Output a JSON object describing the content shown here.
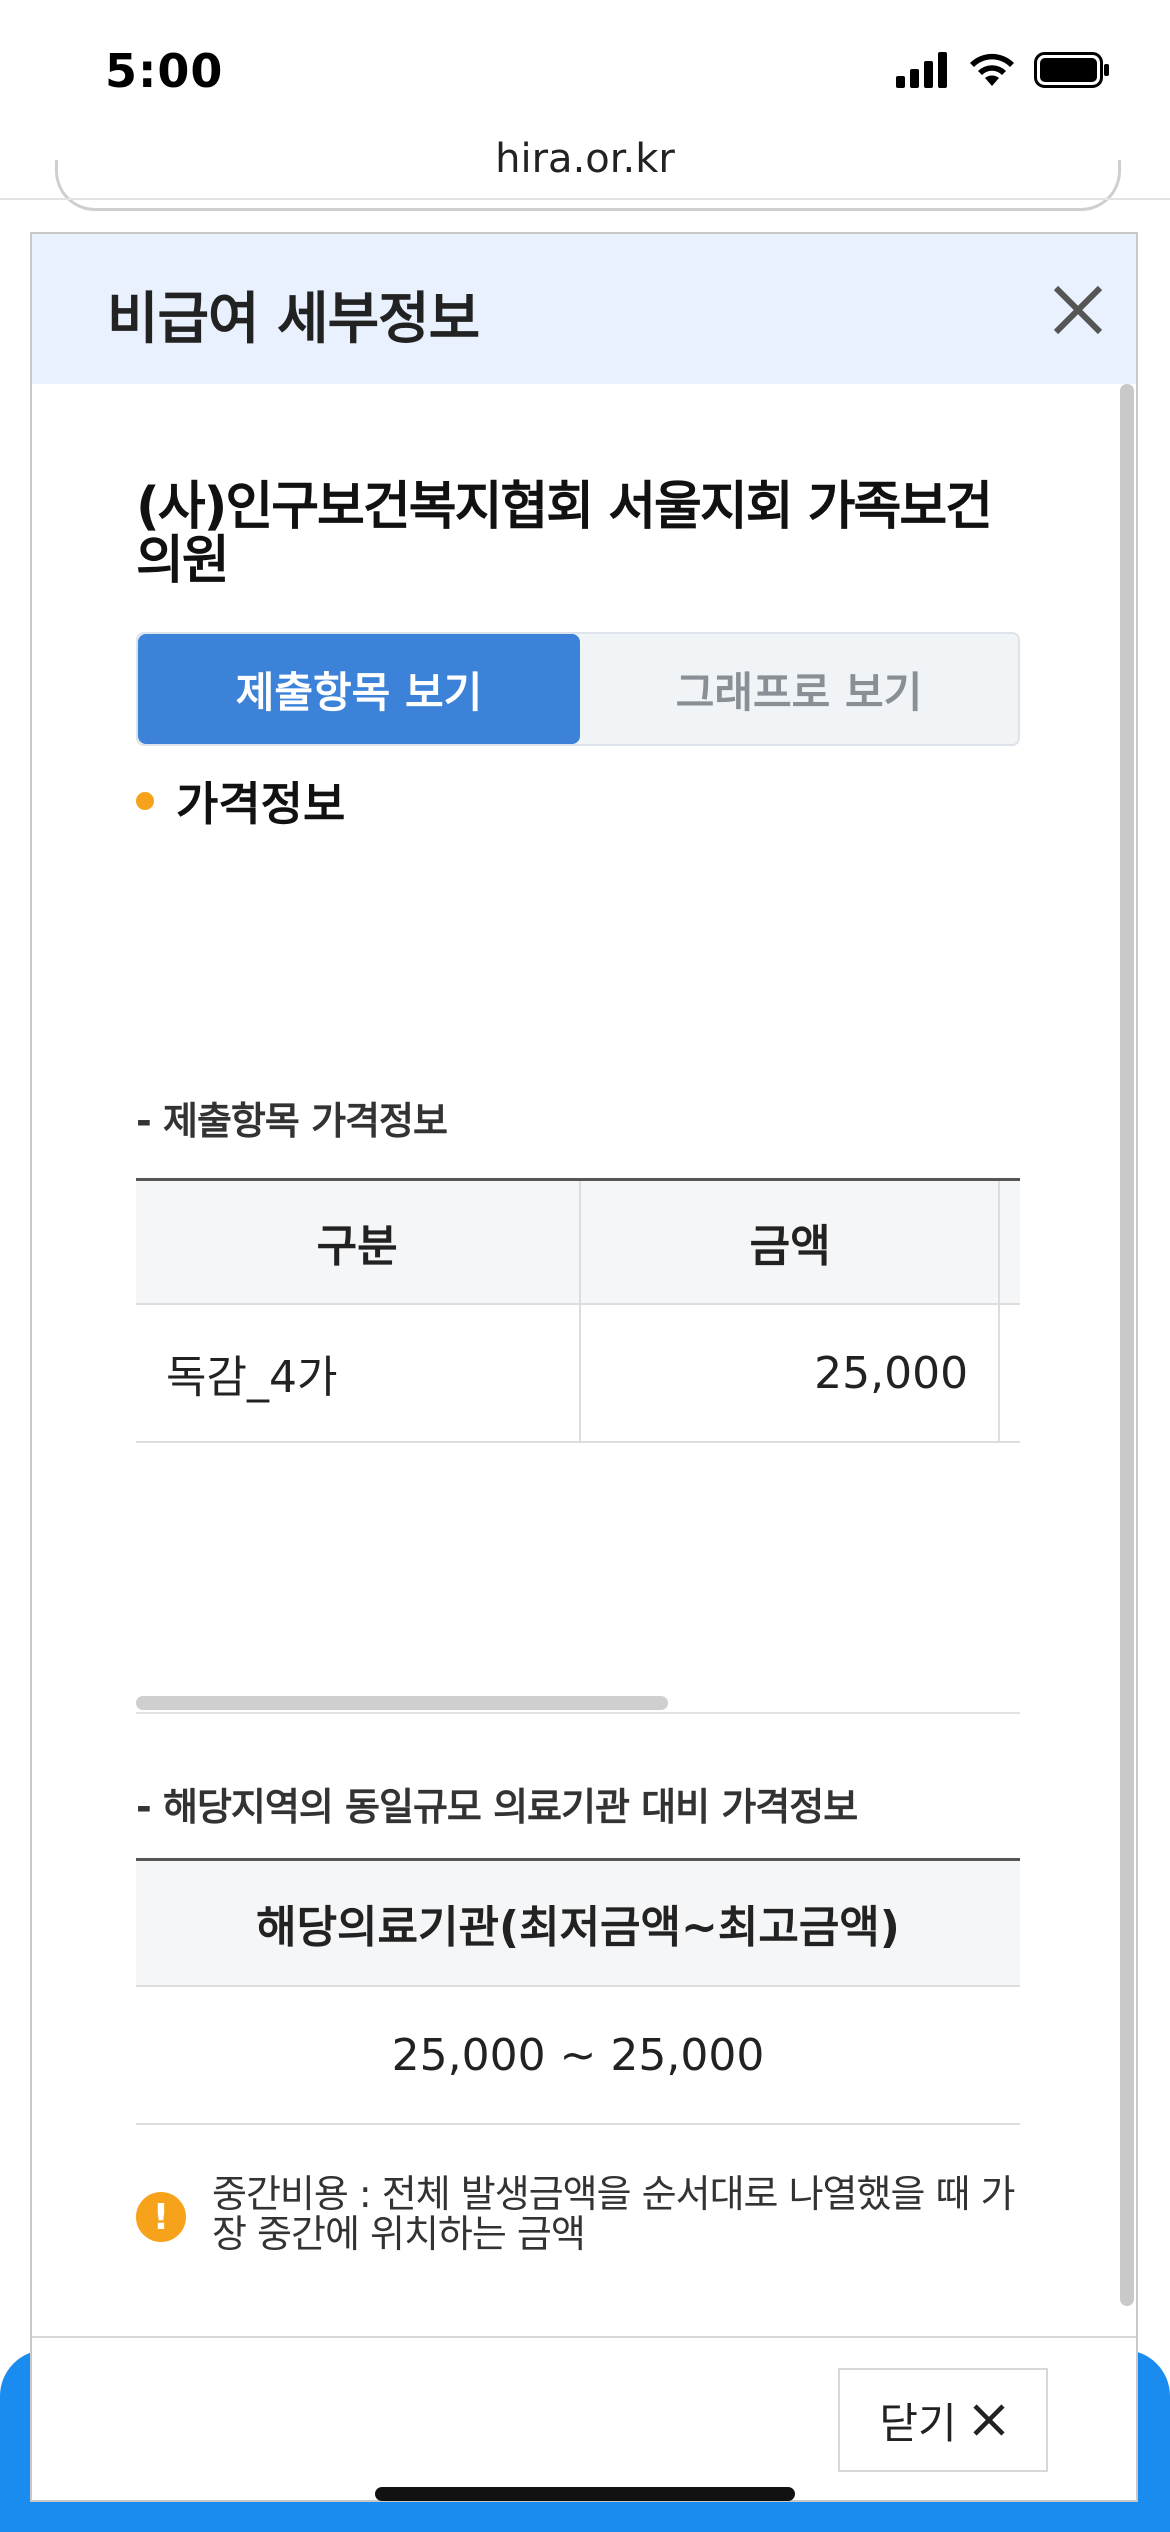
{
  "status": {
    "time": "5:00"
  },
  "browser": {
    "url": "hira.or.kr"
  },
  "modal": {
    "title": "비급여 세부정보",
    "hospital_name": "(사)인구보건복지협회 서울지회 가족보건의원",
    "tabs": {
      "active": "제출항목 보기",
      "inactive": "그래프로 보기"
    },
    "section_title": "가격정보",
    "table1": {
      "subtitle": "- 제출항목 가격정보",
      "headers": [
        "구분",
        "금액"
      ],
      "rows": [
        {
          "name": "독감_4가",
          "price": "25,000"
        }
      ]
    },
    "table2": {
      "subtitle": "- 해당지역의 동일규모 의료기관 대비 가격정보",
      "header": "해당의료기관(최저금액~최고금액)",
      "value": "25,000 ~ 25,000"
    },
    "note": "중간비용 : 전체 발생금액을 순서대로 나열했을 때 가장 중간에 위치하는 금액",
    "close_label": "닫기"
  },
  "colors": {
    "accent": "#3b82d8",
    "bullet": "#f7a21b",
    "header_bg": "#e8f1fd"
  }
}
